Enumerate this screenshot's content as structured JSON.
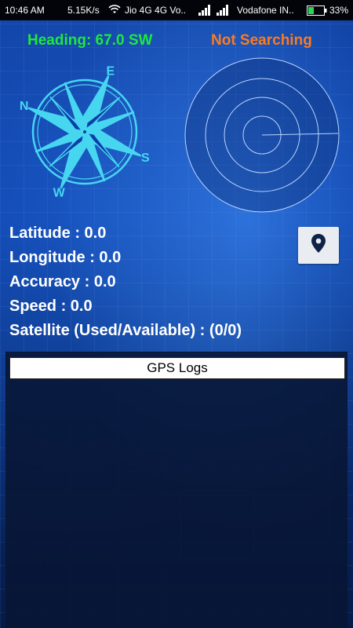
{
  "status_bar": {
    "time": "10:46 AM",
    "net_speed": "5.15K/s",
    "network1": "Jio 4G 4G  Vo..",
    "network2": "Vodafone IN..",
    "battery": "33%"
  },
  "gps": {
    "heading": "Heading: 67.0 SW",
    "search_status": "Not Searching",
    "latitude_label": "Latitude : ",
    "latitude_value": "0.0",
    "longitude_label": "Longitude : ",
    "longitude_value": "0.0",
    "accuracy_label": "Accuracy : ",
    "accuracy_value": "0.0",
    "speed_label": "Speed : ",
    "speed_value": "0.0",
    "satellite_label": "Satellite (Used/Available) : ",
    "satellite_value": "(0/0)"
  },
  "compass": {
    "letters": [
      "N",
      "S",
      "E",
      "W"
    ]
  },
  "logs": {
    "title": "GPS Logs",
    "entries": []
  },
  "colors": {
    "heading": "#1ee83a",
    "search_status": "#ff7a1a",
    "compass": "#47d6f0"
  },
  "icons": {
    "map_button": "location-pin-icon"
  }
}
